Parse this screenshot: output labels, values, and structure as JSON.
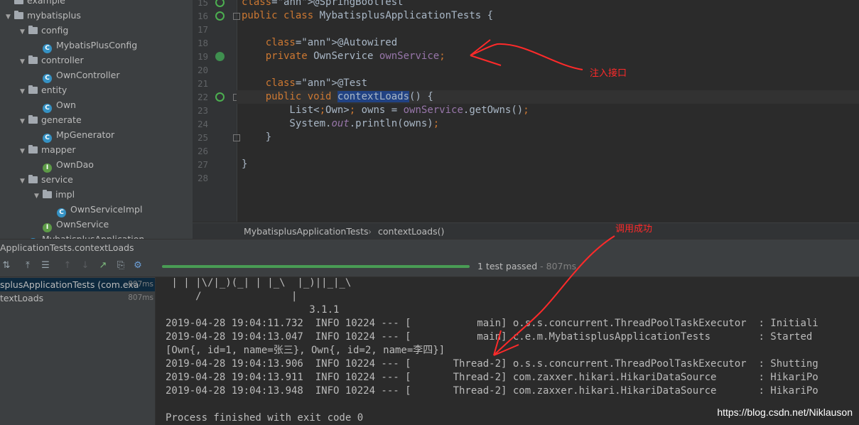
{
  "project_tree": [
    {
      "label": "example",
      "kind": "folder",
      "depth": 0,
      "arrow": ""
    },
    {
      "label": "mybatisplus",
      "kind": "folder",
      "depth": 0,
      "arrow": "▼"
    },
    {
      "label": "config",
      "kind": "folder",
      "depth": 1,
      "arrow": "▼"
    },
    {
      "label": "MybatisPlusConfig",
      "kind": "class",
      "depth": 2
    },
    {
      "label": "controller",
      "kind": "folder",
      "depth": 1,
      "arrow": "▼"
    },
    {
      "label": "OwnController",
      "kind": "class",
      "depth": 2
    },
    {
      "label": "entity",
      "kind": "folder",
      "depth": 1,
      "arrow": "▼"
    },
    {
      "label": "Own",
      "kind": "class",
      "depth": 2
    },
    {
      "label": "generate",
      "kind": "folder",
      "depth": 1,
      "arrow": "▼"
    },
    {
      "label": "MpGenerator",
      "kind": "class",
      "depth": 2
    },
    {
      "label": "mapper",
      "kind": "folder",
      "depth": 1,
      "arrow": "▼"
    },
    {
      "label": "OwnDao",
      "kind": "interface",
      "depth": 2
    },
    {
      "label": "service",
      "kind": "folder",
      "depth": 1,
      "arrow": "▼"
    },
    {
      "label": "impl",
      "kind": "folder",
      "depth": 2,
      "arrow": "▼"
    },
    {
      "label": "OwnServiceImpl",
      "kind": "class",
      "depth": 3
    },
    {
      "label": "OwnService",
      "kind": "interface",
      "depth": 2
    },
    {
      "label": "MybatisplusApplication",
      "kind": "class",
      "depth": 1
    }
  ],
  "editor": {
    "lines": [
      {
        "n": "15",
        "text": "@SpringBootTest"
      },
      {
        "n": "16",
        "text": "public class MybatisplusApplicationTests {"
      },
      {
        "n": "17",
        "text": ""
      },
      {
        "n": "18",
        "text": "    @Autowired"
      },
      {
        "n": "19",
        "text": "    private OwnService ownService;"
      },
      {
        "n": "20",
        "text": ""
      },
      {
        "n": "21",
        "text": "    @Test"
      },
      {
        "n": "22",
        "text": "    public void contextLoads() {"
      },
      {
        "n": "23",
        "text": "        List<Own> owns = ownService.getOwns();"
      },
      {
        "n": "24",
        "text": "        System.out.println(owns);"
      },
      {
        "n": "25",
        "text": "    }"
      },
      {
        "n": "26",
        "text": ""
      },
      {
        "n": "27",
        "text": "}"
      },
      {
        "n": "28",
        "text": ""
      }
    ],
    "breadcrumb": [
      "MybatisplusApplicationTests",
      "contextLoads()"
    ]
  },
  "run_panel": {
    "title": "ApplicationTests.contextLoads",
    "status_text": "1 test passed",
    "status_time": " - 807ms",
    "tests": [
      {
        "label": "splusApplicationTests (com.exa",
        "duration": "807ms",
        "selected": true
      },
      {
        "label": "textLoads",
        "duration": "807ms",
        "selected": false
      }
    ],
    "console_lines": [
      " | | |\\/|_)(_| | |_\\  |_)||_|_\\",
      "     /               |",
      "                        3.1.1",
      "2019-04-28 19:04:11.732  INFO 10224 --- [           main] o.s.s.concurrent.ThreadPoolTaskExecutor  : Initiali",
      "2019-04-28 19:04:13.047  INFO 10224 --- [           main] c.e.m.MybatisplusApplicationTests        : Started",
      "[Own{, id=1, name=张三}, Own{, id=2, name=李四}]",
      "2019-04-28 19:04:13.906  INFO 10224 --- [       Thread-2] o.s.s.concurrent.ThreadPoolTaskExecutor  : Shutting",
      "2019-04-28 19:04:13.911  INFO 10224 --- [       Thread-2] com.zaxxer.hikari.HikariDataSource       : HikariPo",
      "2019-04-28 19:04:13.948  INFO 10224 --- [       Thread-2] com.zaxxer.hikari.HikariDataSource       : HikariPo",
      "",
      "Process finished with exit code 0"
    ]
  },
  "annotations": {
    "inject": "注入接口",
    "success": "调用成功",
    "color": "#ff2a2a"
  },
  "watermark": "https://blog.csdn.net/Niklauson",
  "colors": {
    "keyword": "#cc7832",
    "annotation": "#bbb529",
    "field": "#9876aa",
    "selection": "#214283",
    "progress": "#499c54"
  }
}
